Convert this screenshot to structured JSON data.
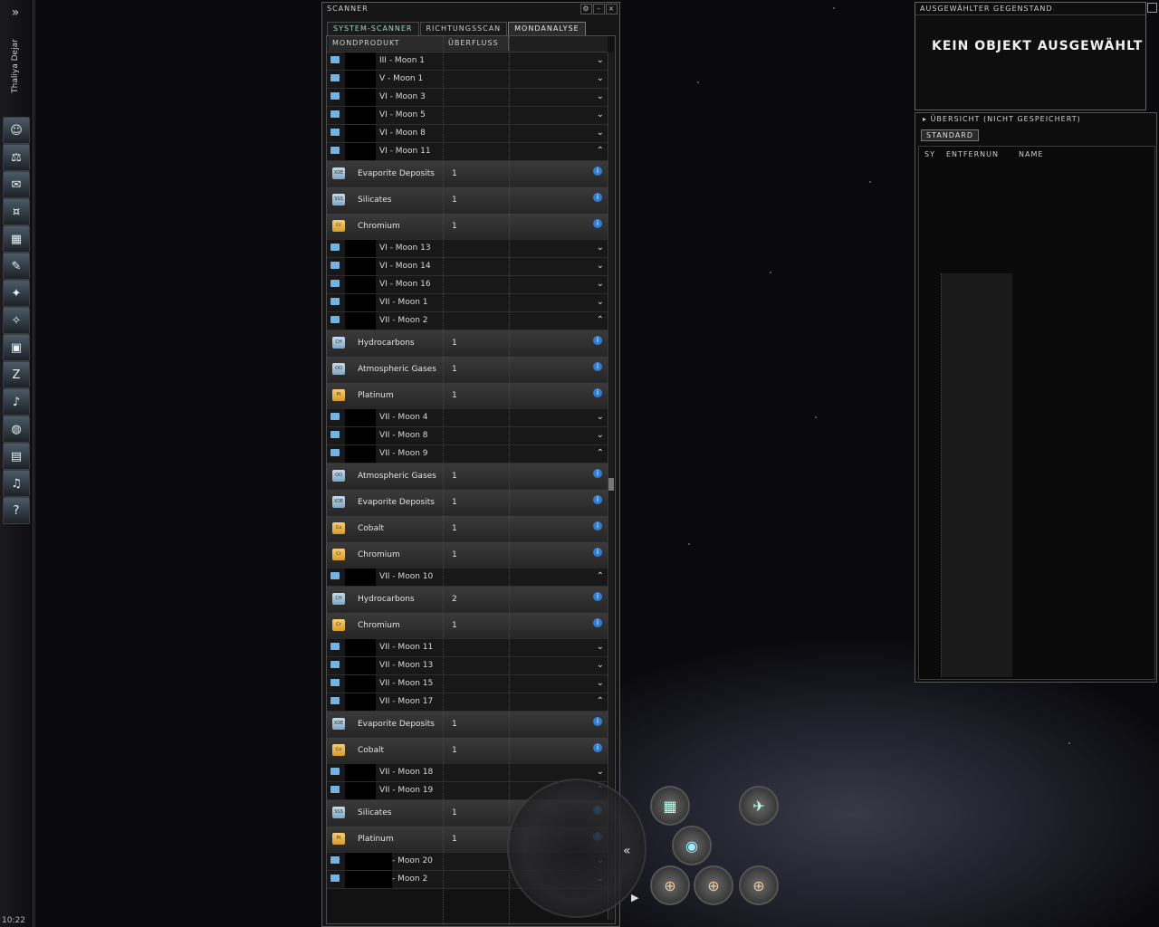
{
  "neocom": {
    "expand_icon": "»",
    "pilot_name": "Thaliya Dejar",
    "buttons": [
      "character-sheet",
      "market",
      "mail",
      "wallet",
      "map",
      "contracts",
      "fleet",
      "corp",
      "assets",
      "people",
      "journal",
      "starmap",
      "news",
      "science",
      "help"
    ],
    "time": "10:22"
  },
  "scanner": {
    "title": "SCANNER",
    "tabs": [
      "SYSTEM-SCANNER",
      "RICHTUNGSSCAN",
      "MONDANALYSE"
    ],
    "active_tab": "MONDANALYSE",
    "columns": [
      "MONDPRODUKT",
      "ÜBERFLUSS"
    ],
    "rows": [
      {
        "type": "moon",
        "label": "III - Moon 1",
        "chev": "down"
      },
      {
        "type": "moon",
        "label": "V - Moon 1",
        "chev": "down"
      },
      {
        "type": "moon",
        "label": "VI - Moon 3",
        "chev": "down"
      },
      {
        "type": "moon",
        "label": "VI - Moon 5",
        "chev": "down"
      },
      {
        "type": "moon",
        "label": "VI - Moon 8",
        "chev": "down"
      },
      {
        "type": "moon",
        "label": "VI - Moon 11",
        "chev": "up"
      },
      {
        "type": "product",
        "label": "Evaporite Deposits",
        "value": "1",
        "color": "blue",
        "tag": "XDE"
      },
      {
        "type": "product",
        "label": "Silicates",
        "value": "1",
        "color": "blue",
        "tag": "SSS"
      },
      {
        "type": "product",
        "label": "Chromium",
        "value": "1",
        "color": "gold",
        "tag": "Cr"
      },
      {
        "type": "moon",
        "label": "VI - Moon 13",
        "chev": "down"
      },
      {
        "type": "moon",
        "label": "VI - Moon 14",
        "chev": "down"
      },
      {
        "type": "moon",
        "label": "VI - Moon 16",
        "chev": "down"
      },
      {
        "type": "moon",
        "label": "VII - Moon 1",
        "chev": "down"
      },
      {
        "type": "moon",
        "label": "VII - Moon 2",
        "chev": "up"
      },
      {
        "type": "product",
        "label": "Hydrocarbons",
        "value": "1",
        "color": "blue",
        "tag": "CH"
      },
      {
        "type": "product",
        "label": "Atmospheric Gases",
        "value": "1",
        "color": "blue",
        "tag": "OO"
      },
      {
        "type": "product",
        "label": "Platinum",
        "value": "1",
        "color": "gold",
        "tag": "Pt"
      },
      {
        "type": "moon",
        "label": "VII - Moon 4",
        "chev": "down"
      },
      {
        "type": "moon",
        "label": "VII - Moon 8",
        "chev": "down"
      },
      {
        "type": "moon",
        "label": "VII - Moon 9",
        "chev": "up"
      },
      {
        "type": "product",
        "label": "Atmospheric Gases",
        "value": "1",
        "color": "blue",
        "tag": "OO"
      },
      {
        "type": "product",
        "label": "Evaporite Deposits",
        "value": "1",
        "color": "blue",
        "tag": "XDE"
      },
      {
        "type": "product",
        "label": "Cobalt",
        "value": "1",
        "color": "gold",
        "tag": "Co"
      },
      {
        "type": "product",
        "label": "Chromium",
        "value": "1",
        "color": "gold",
        "tag": "Cr"
      },
      {
        "type": "moon",
        "label": "VII - Moon 10",
        "chev": "up"
      },
      {
        "type": "product",
        "label": "Hydrocarbons",
        "value": "2",
        "color": "blue",
        "tag": "CH"
      },
      {
        "type": "product",
        "label": "Chromium",
        "value": "1",
        "color": "gold",
        "tag": "Cr"
      },
      {
        "type": "moon",
        "label": "VII - Moon 11",
        "chev": "down"
      },
      {
        "type": "moon",
        "label": "VII - Moon 13",
        "chev": "down"
      },
      {
        "type": "moon",
        "label": "VII - Moon 15",
        "chev": "down"
      },
      {
        "type": "moon",
        "label": "VII - Moon 17",
        "chev": "up"
      },
      {
        "type": "product",
        "label": "Evaporite Deposits",
        "value": "1",
        "color": "blue",
        "tag": "XDE"
      },
      {
        "type": "product",
        "label": "Cobalt",
        "value": "1",
        "color": "gold",
        "tag": "Co"
      },
      {
        "type": "moon",
        "label": "VII - Moon 18",
        "chev": "down"
      },
      {
        "type": "moon",
        "label": "VII - Moon 19",
        "chev": "up"
      },
      {
        "type": "product",
        "label": "Silicates",
        "value": "1",
        "color": "blue",
        "tag": "SSS"
      },
      {
        "type": "product",
        "label": "Platinum",
        "value": "1",
        "color": "gold",
        "tag": "Pt"
      },
      {
        "type": "moon",
        "label": "- Moon 20",
        "chev": "down",
        "wide": true
      },
      {
        "type": "moon",
        "label": "- Moon 2",
        "chev": "down",
        "wide": true
      }
    ]
  },
  "selected_item": {
    "title": "AUSGEWÄHLTER GEGENSTAND",
    "message": "KEIN OBJEKT AUSGEWÄHLT"
  },
  "overview": {
    "title": "ÜBERSICHT (NICHT GESPEICHERT)",
    "tab": "STANDARD",
    "columns": [
      "SY",
      "ENTFERNUN",
      "NAME"
    ]
  },
  "colors": {
    "accent_blue": "#2f7fd6",
    "product_blue": "#7fa6c3",
    "product_gold": "#d8992a"
  }
}
